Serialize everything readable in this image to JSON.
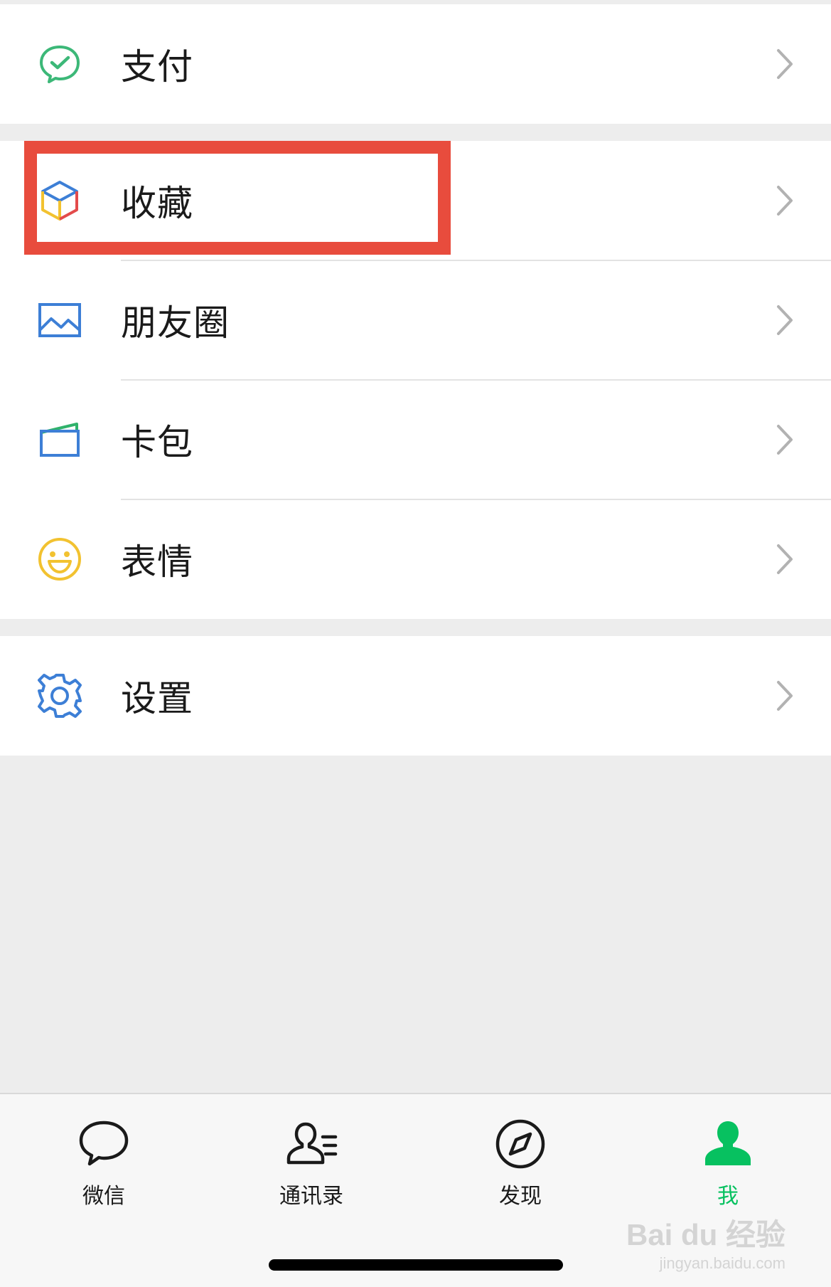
{
  "menu": {
    "pay": {
      "label": "支付",
      "icon": "wechat-pay-icon"
    },
    "favorites": {
      "label": "收藏",
      "icon": "favorites-cube-icon"
    },
    "moments": {
      "label": "朋友圈",
      "icon": "album-picture-icon"
    },
    "cards": {
      "label": "卡包",
      "icon": "card-wallet-icon"
    },
    "stickers": {
      "label": "表情",
      "icon": "smiley-face-icon"
    },
    "settings": {
      "label": "设置",
      "icon": "gear-icon"
    }
  },
  "tabbar": {
    "tabs": [
      {
        "label": "微信",
        "icon": "chat-bubble-icon",
        "active": false
      },
      {
        "label": "通讯录",
        "icon": "contacts-icon",
        "active": false
      },
      {
        "label": "发现",
        "icon": "compass-icon",
        "active": false
      },
      {
        "label": "我",
        "icon": "person-icon",
        "active": true
      }
    ]
  },
  "watermark": {
    "main": "Bai du 经验",
    "sub": "jingyan.baidu.com"
  },
  "colors": {
    "accent_green": "#07c160",
    "highlight_red": "#e84c3d",
    "background": "#ededed"
  }
}
